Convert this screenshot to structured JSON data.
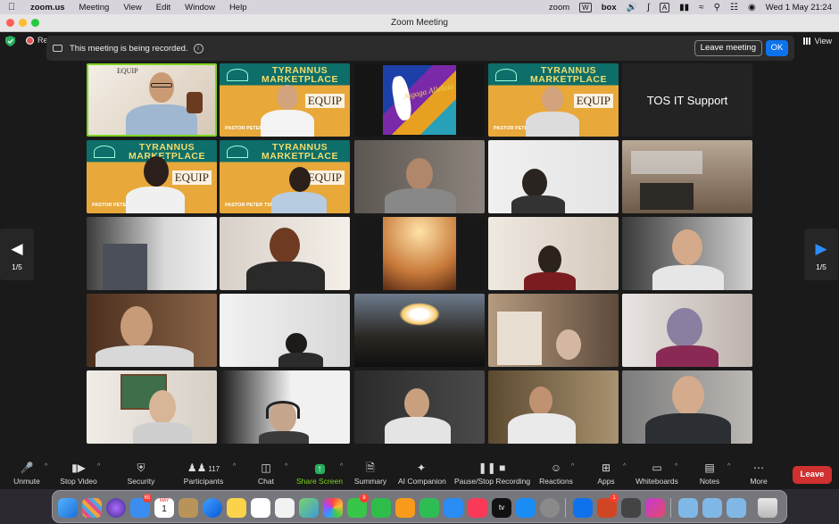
{
  "menubar": {
    "app_name": "zoom.us",
    "menus": [
      "Meeting",
      "View",
      "Edit",
      "Window",
      "Help"
    ],
    "status_items": [
      "zoom",
      "box"
    ],
    "datetime": "Wed 1 May  21:24"
  },
  "window": {
    "title": "Zoom Meeting"
  },
  "recording": {
    "short_label": "Re",
    "banner_text": "This meeting is being recorded.",
    "leave_meeting_label": "Leave meeting",
    "ok_label": "OK"
  },
  "view_button": {
    "label": "View"
  },
  "pagination": {
    "left": "1/5",
    "right": "1/5"
  },
  "tiles": {
    "poster_title": "TYRANNUS MARKETPLACE",
    "poster_equip": "EQUIP",
    "poster_pastor": "PASTOR PETER TSUKAHIRA",
    "equip_small": "EQUIP",
    "alleluia": "Aigaga Alleluia",
    "it_support": "TOS IT Support"
  },
  "toolbar": {
    "unmute": "Unmute",
    "stop_video": "Stop Video",
    "security": "Security",
    "participants": "Participants",
    "participants_count": "117",
    "chat": "Chat",
    "share_screen": "Share Screen",
    "summary": "Summary",
    "ai_companion": "AI Companion",
    "recording": "Pause/Stop Recording",
    "reactions": "Reactions",
    "apps": "Apps",
    "whiteboards": "Whiteboards",
    "notes": "Notes",
    "more": "More",
    "leave": "Leave"
  },
  "dock": {
    "calendar_month": "MAY",
    "calendar_day": "1",
    "mail_badge": "65",
    "messages_badge": "8",
    "ppt_badge": "1",
    "appletv": "tv"
  },
  "colors": {
    "zoom_blue": "#0e72ed",
    "leave_red": "#d0302f",
    "active_speaker": "#7ed321",
    "share_green": "#27ae60"
  }
}
